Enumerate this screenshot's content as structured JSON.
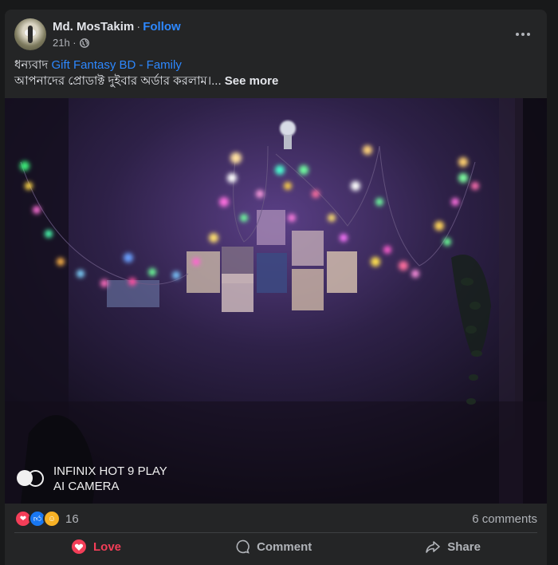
{
  "post": {
    "author": "Md. MosTakim",
    "separator": "·",
    "follow_label": "Follow",
    "time": "21h ·",
    "text_prefix": "ধন্যবাদ",
    "tag": "Gift Fantasy BD - Family",
    "text_line2": "আপনাদের প্রোডাক্ট দুইবার অর্ডার করলাম।...",
    "see_more": "See more"
  },
  "media": {
    "watermark_line1": "INFINIX HOT 9 PLAY",
    "watermark_line2": "AI CAMERA"
  },
  "stats": {
    "reaction_count": "16",
    "comments": "6 comments",
    "reactions": [
      "love",
      "like",
      "care"
    ]
  },
  "actions": {
    "love": "Love",
    "comment": "Comment",
    "share": "Share"
  },
  "colors": {
    "background": "#18191a",
    "card": "#242526",
    "link": "#2d88ff",
    "love": "#f33e58",
    "like": "#1877f2",
    "care": "#f7b125",
    "secondary_text": "#b0b3b8"
  }
}
